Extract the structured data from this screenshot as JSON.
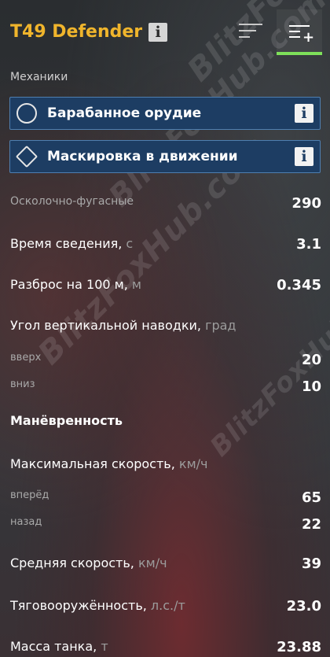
{
  "header": {
    "title": "T49 Defender",
    "info_glyph": "i"
  },
  "mechanics": {
    "label": "Механики",
    "features": [
      {
        "label": "Барабанное орудие",
        "icon": "drum-gun-icon",
        "info": "i"
      },
      {
        "label": "Маскировка в движении",
        "icon": "camo-move-icon",
        "info": "i"
      }
    ]
  },
  "firepower": {
    "he_label": "Осколочно-фугасные",
    "he_value": "290",
    "aim_label": "Время сведения,",
    "aim_unit": "с",
    "aim_value": "3.1",
    "disp_label": "Разброс на 100 м,",
    "disp_unit": "м",
    "disp_value": "0.345",
    "elev_label": "Угол вертикальной наводки,",
    "elev_unit": "град",
    "up_label": "вверх",
    "up_value": "20",
    "down_label": "вниз",
    "down_value": "10"
  },
  "mobility": {
    "heading": "Манёвренность",
    "speed_label": "Максимальная скорость,",
    "speed_unit": "км/ч",
    "fwd_label": "вперёд",
    "fwd_value": "65",
    "back_label": "назад",
    "back_value": "22",
    "avg_label": "Средняя скорость,",
    "avg_unit": "км/ч",
    "avg_value": "39",
    "pw_label": "Тяговооружённость,",
    "pw_unit": "л.с./т",
    "pw_value": "23.0",
    "mass_label": "Масса танка,",
    "mass_unit": "т",
    "mass_value": "23.88"
  },
  "watermark": "BlitzFoxHub.com",
  "colors": {
    "title": "#f0b52c",
    "feature_bg": "#1d3d63",
    "feature_border": "#4f7fb0",
    "active_tab": "#7ee05a"
  }
}
